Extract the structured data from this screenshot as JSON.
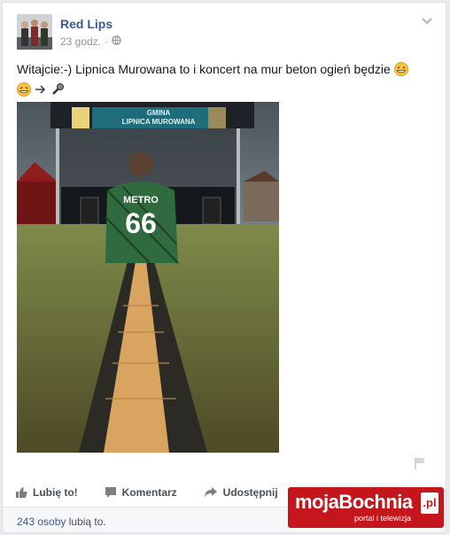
{
  "post": {
    "author": "Red Lips",
    "time": "23 godz.",
    "meta_separator": "·",
    "text": "Witajcie:-) Lipnica Murowana to i koncert na mur beton ogień będzie",
    "photo_banner_line1": "GMINA",
    "photo_banner_line2": "LIPNICA MUROWANA",
    "photo_jersey_name": "METRO",
    "photo_jersey_number": "66"
  },
  "actions": {
    "like_label": "Lubię to!",
    "comment_label": "Komentarz",
    "share_label": "Udostępnij"
  },
  "likes": {
    "count": "243 osoby",
    "suffix": "lubią to."
  },
  "watermark": {
    "brand": "mojaBochnia",
    "tld": ".pl",
    "tagline": "portal i telewizja"
  },
  "colors": {
    "link": "#3b5998",
    "watermark_red": "#c4161c",
    "muted": "#90949c"
  },
  "icons": [
    "globe-icon",
    "chevron-down-icon",
    "flag-icon",
    "thumbs-up-icon",
    "comment-icon",
    "share-icon"
  ]
}
